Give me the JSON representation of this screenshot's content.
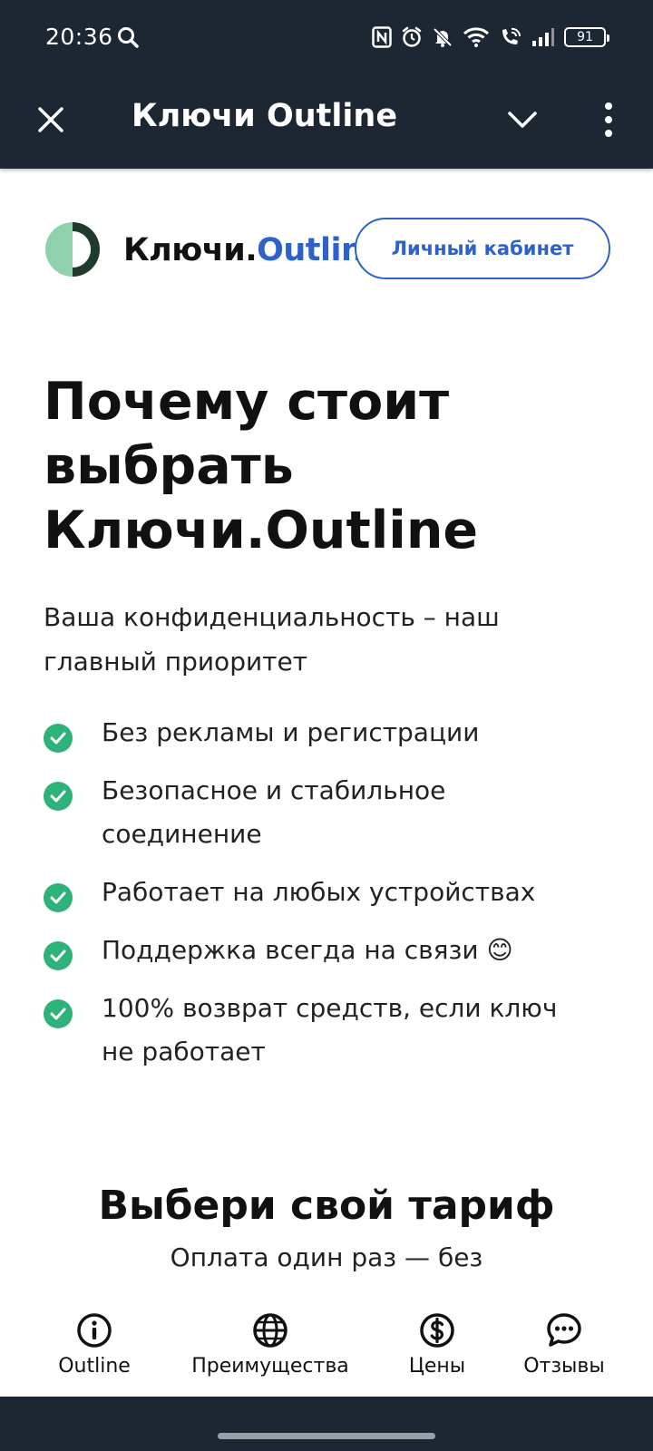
{
  "status_bar": {
    "time": "20:36",
    "battery": "91",
    "icons": [
      "search-icon",
      "nfc-icon",
      "alarm-icon",
      "mute-icon",
      "wifi-icon",
      "wifi-call-icon",
      "signal-icon",
      "battery-icon"
    ]
  },
  "toolbar": {
    "title": "Ключи Outline",
    "icons": [
      "close-icon",
      "chevron-down-icon",
      "more-vertical-icon"
    ]
  },
  "header": {
    "brand_main": "Ключи.",
    "brand_accent": "Outline",
    "cabinet_button": "Личный кабинет"
  },
  "hero": {
    "title_line1": "Почему стоит",
    "title_line2": "выбрать",
    "title_line3": "Ключи.Outline",
    "subtitle_line1": "Ваша конфиденциальность – наш",
    "subtitle_line2": "главный приоритет"
  },
  "features": [
    {
      "line1": "Без рекламы и регистрации",
      "line2": ""
    },
    {
      "line1": "Безопасное и стабильное",
      "line2": "соединение"
    },
    {
      "line1": "Работает на любых устройствах",
      "line2": ""
    },
    {
      "line1": "Поддержка всегда на связи 😊",
      "line2": ""
    },
    {
      "line1": "100% возврат средств, если ключ",
      "line2": "не работает"
    }
  ],
  "plans": {
    "title": "Выбери свой тариф",
    "subtitle": "Оплата один раз — без"
  },
  "bottom_nav": [
    {
      "label": "Outline",
      "icon": "info-icon"
    },
    {
      "label": "Преимущества",
      "icon": "globe-icon"
    },
    {
      "label": "Цены",
      "icon": "dollar-icon"
    },
    {
      "label": "Отзывы",
      "icon": "chat-icon"
    }
  ],
  "colors": {
    "bar_background": "#1d2633",
    "accent_blue": "#2c62c9",
    "check_green": "#2fb27a",
    "logo_dark": "#1f3b2c",
    "logo_light": "#8fd1ad"
  }
}
